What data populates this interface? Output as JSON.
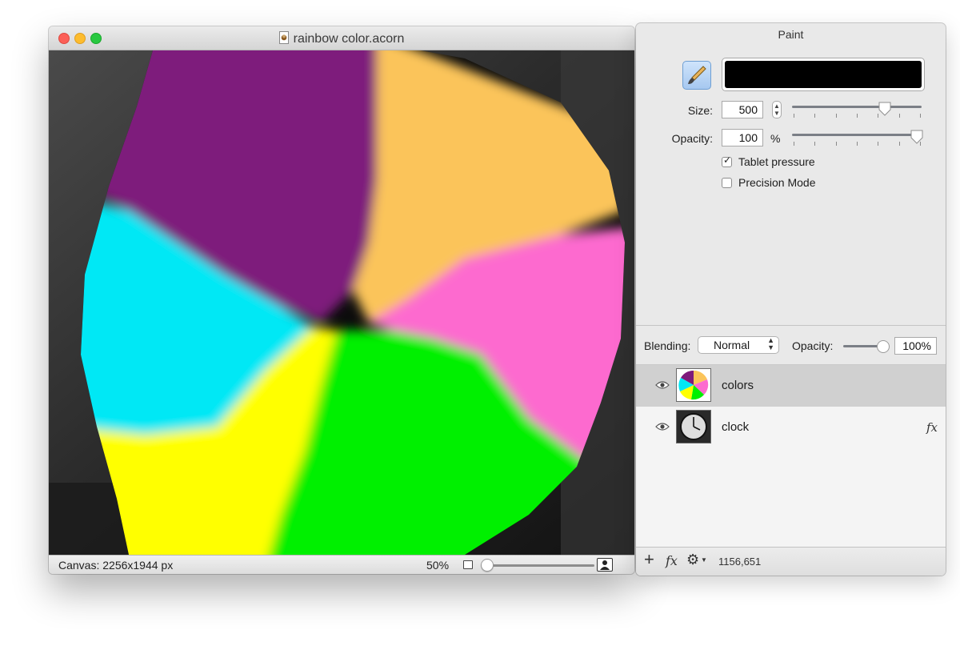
{
  "document_window": {
    "title": "rainbow color.acorn",
    "status": {
      "canvas_info": "Canvas: 2256x1944 px",
      "zoom": "50%",
      "zoom_slider_fraction": 0.02
    }
  },
  "panel": {
    "title": "Paint",
    "brush_color": "#000000",
    "size_label": "Size:",
    "size_value": "500",
    "size_slider_fraction": 0.73,
    "opacity_label": "Opacity:",
    "opacity_value": "100",
    "opacity_unit": "%",
    "opacity_slider_fraction": 1.0,
    "tablet_pressure": {
      "label": "Tablet pressure",
      "checked": true
    },
    "precision_mode": {
      "label": "Precision Mode",
      "checked": false
    },
    "blending_label": "Blending:",
    "blending_value": "Normal",
    "layer_opacity_label": "Opacity:",
    "layer_opacity_value": "100%",
    "layers": [
      {
        "name": "colors",
        "selected": true,
        "visible": true
      },
      {
        "name": "clock",
        "selected": false,
        "visible": true,
        "fx_badge": "fx"
      }
    ],
    "footer": {
      "add_icon": "+",
      "fx_label": "fx",
      "gear_icon": "⚙",
      "coordinates": "1156,651"
    }
  },
  "colors": {
    "purple": "#7e1a7c",
    "orange": "#fbc45a",
    "pink": "#fd6bcf",
    "cyan": "#00e8f5",
    "yellow": "#ffff00",
    "green": "#00f000"
  }
}
